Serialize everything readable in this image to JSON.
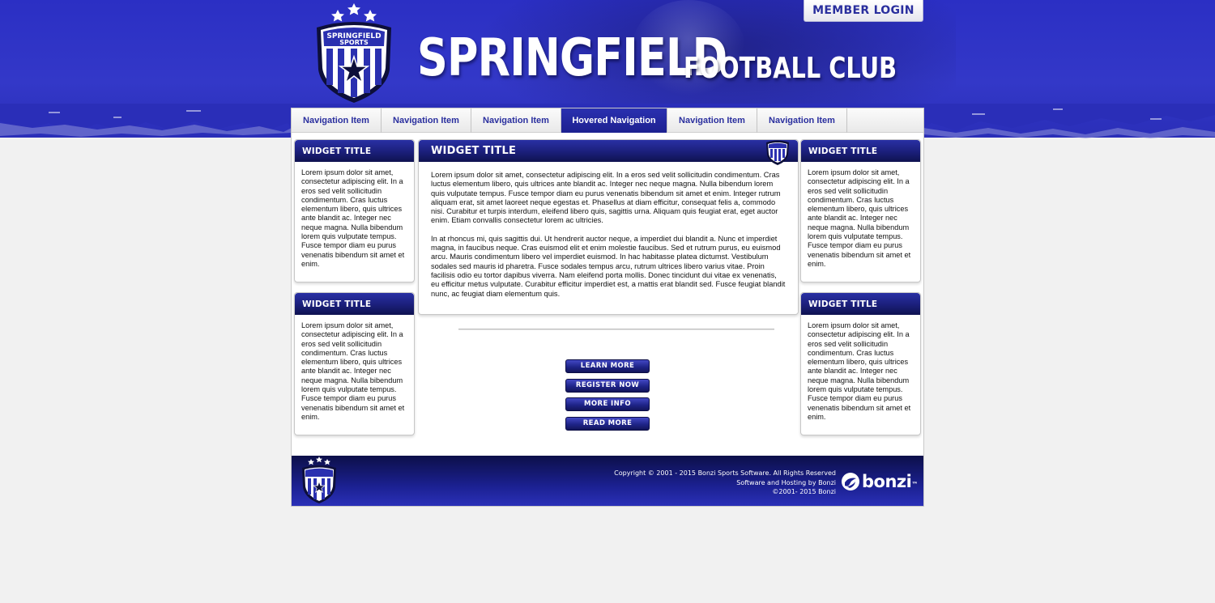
{
  "header": {
    "member_login": "MEMBER LOGIN",
    "brand_main": "SPRINGFIELD",
    "brand_sub": "FOOTBALL CLUB",
    "crest_text": "SPRINGFIELD SPORTS"
  },
  "nav": {
    "items": [
      {
        "label": "Navigation Item"
      },
      {
        "label": "Navigation Item"
      },
      {
        "label": "Navigation Item"
      },
      {
        "label": "Hovered Navigation"
      },
      {
        "label": "Navigation Item"
      },
      {
        "label": "Navigation Item"
      }
    ]
  },
  "widgets": {
    "left_top": {
      "title": "WIDGET TITLE",
      "body": "Lorem ipsum dolor sit amet, consectetur adipiscing elit. In a eros sed velit sollicitudin condimentum. Cras luctus elementum libero, quis ultrices ante blandit ac. Integer nec neque magna. Nulla bibendum lorem quis vulputate tempus. Fusce tempor diam eu purus venenatis bibendum sit amet et enim."
    },
    "left_bottom": {
      "title": "WIDGET TITLE",
      "body": "Lorem ipsum dolor sit amet, consectetur adipiscing elit. In a eros sed velit sollicitudin condimentum. Cras luctus elementum libero, quis ultrices ante blandit ac. Integer nec neque magna. Nulla bibendum lorem quis vulputate tempus. Fusce tempor diam eu purus venenatis bibendum sit amet et enim."
    },
    "main": {
      "title": "WIDGET TITLE",
      "paragraph1": "Lorem ipsum dolor sit amet, consectetur adipiscing elit. In a eros sed velit sollicitudin condimentum. Cras luctus elementum libero, quis ultrices ante blandit ac. Integer nec neque magna. Nulla bibendum lorem quis vulputate tempus. Fusce tempor diam eu purus venenatis bibendum sit amet et enim. Integer rutrum aliquam erat, sit amet laoreet neque egestas et. Phasellus at diam efficitur, consequat felis a, commodo nisi. Curabitur et turpis interdum, eleifend libero quis, sagittis urna. Aliquam quis feugiat erat, eget auctor enim. Etiam convallis consectetur lorem ac ultricies.",
      "paragraph2": "In at rhoncus mi, quis sagittis dui. Ut hendrerit auctor neque, a imperdiet dui blandit a. Nunc et imperdiet magna, in faucibus neque. Cras euismod elit et enim molestie faucibus. Sed et rutrum purus, eu euismod arcu. Mauris condimentum libero vel imperdiet euismod. In hac habitasse platea dictumst. Vestibulum sodales sed mauris id pharetra. Fusce sodales tempus arcu, rutrum ultrices libero varius vitae. Proin facilisis odio eu tortor dapibus viverra. Nam eleifend porta mollis. Donec tincidunt dui vitae ex venenatis, eu efficitur metus vulputate. Curabitur efficitur imperdiet est, a mattis erat blandit sed. Fusce feugiat blandit nunc, ac feugiat diam elementum quis."
    },
    "right_top": {
      "title": "WIDGET TITLE",
      "body": "Lorem ipsum dolor sit amet, consectetur adipiscing elit. In a eros sed velit sollicitudin condimentum. Cras luctus elementum libero, quis ultrices ante blandit ac. Integer nec neque magna. Nulla bibendum lorem quis vulputate tempus. Fusce tempor diam eu purus venenatis bibendum sit amet et enim."
    },
    "right_bottom": {
      "title": "WIDGET TITLE",
      "body": "Lorem ipsum dolor sit amet, consectetur adipiscing elit. In a eros sed velit sollicitudin condimentum. Cras luctus elementum libero, quis ultrices ante blandit ac. Integer nec neque magna. Nulla bibendum lorem quis vulputate tempus. Fusce tempor diam eu purus venenatis bibendum sit amet et enim."
    }
  },
  "buttons": {
    "learn_more": "LEARN MORE",
    "register_now": "REGISTER NOW",
    "more_info": "MORE INFO",
    "read_more": "READ MORE"
  },
  "footer": {
    "copyright": "Copyright © 2001 - 2015 Bonzi Sports Software.  All Rights Reserved",
    "hosting": "Software and Hosting by Bonzi",
    "years": "©2001- 2015 Bonzi",
    "bonzi_logo": "bonzi",
    "bonzi_tm": "™"
  },
  "colors": {
    "brand_blue": "#2b2fc4",
    "navy": "#1b1f7a",
    "nav_text": "#2a2f9e",
    "page_bg": "#f1f1f1"
  },
  "icons": {
    "crest": "crest-logo-icon",
    "stars": "star-icon",
    "bonzi": "bonzi-logo-icon"
  }
}
